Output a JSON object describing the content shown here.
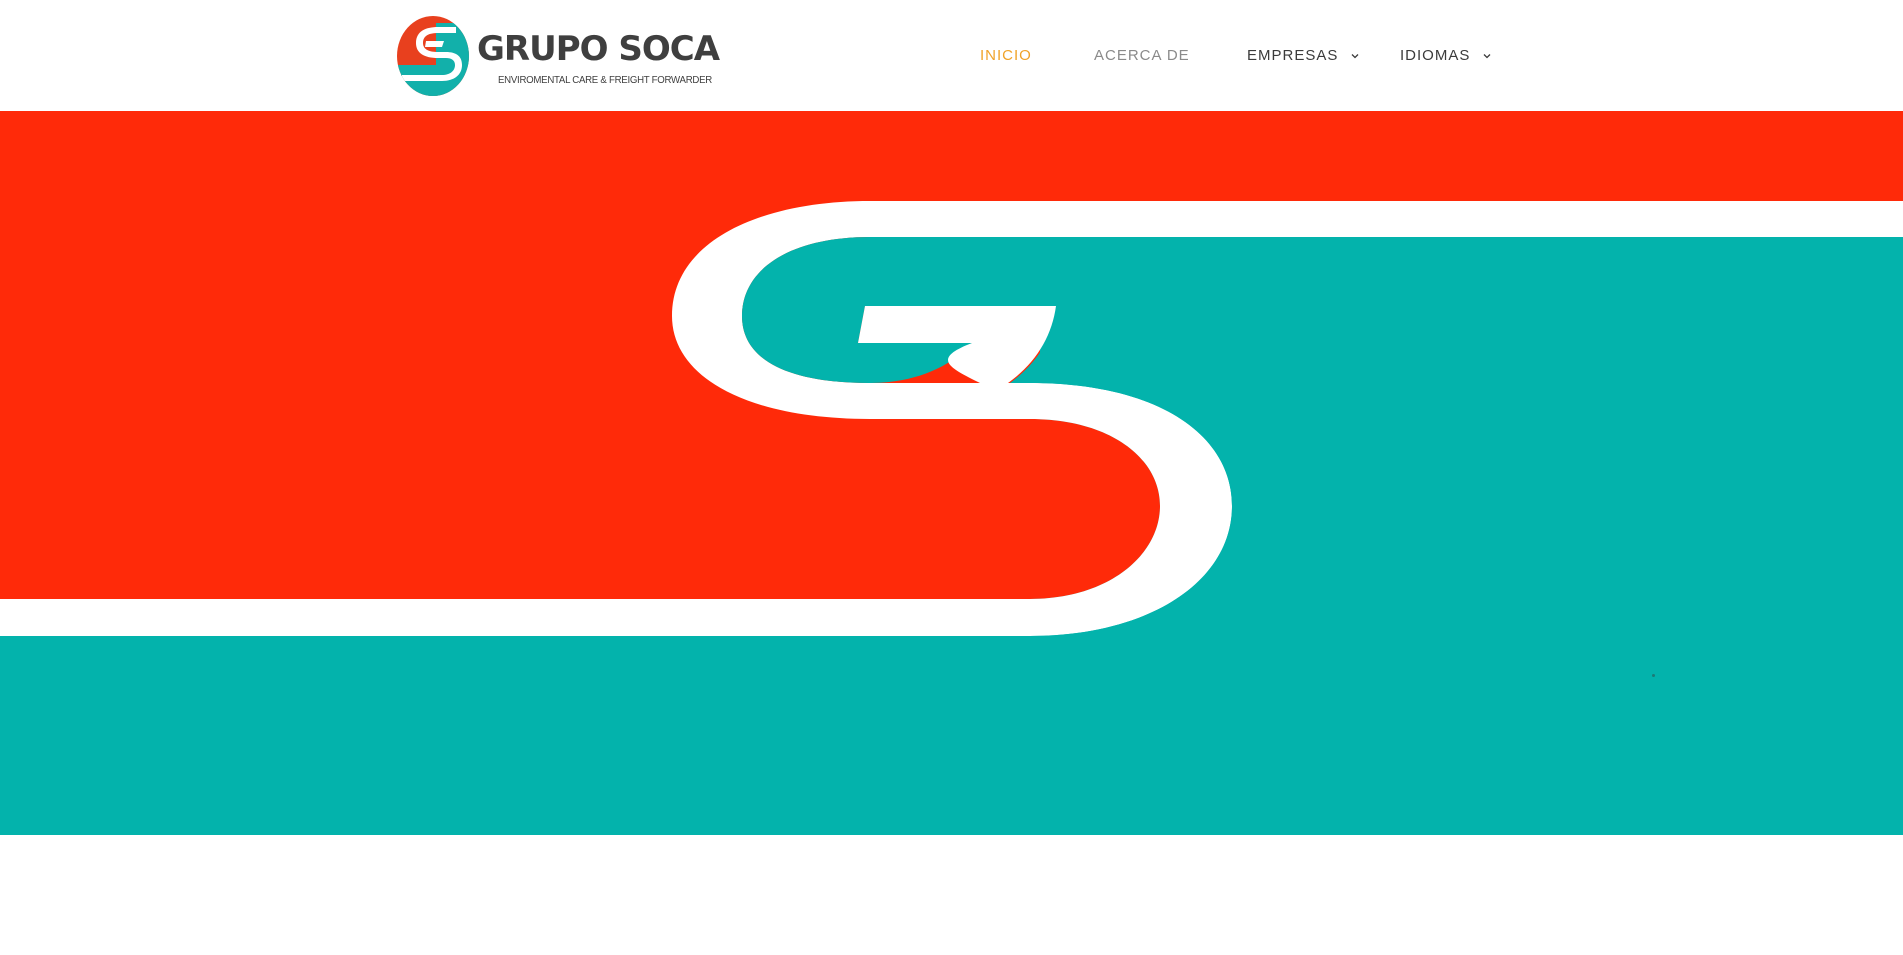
{
  "header": {
    "logo": {
      "title": "GRUPO SOCA",
      "tagline": "ENVIROMENTAL CARE & FREIGHT FORWARDER",
      "icon": "grupo-soca-logo-mark"
    },
    "nav": {
      "items": [
        {
          "label": "INICIO",
          "state": "active"
        },
        {
          "label": "ACERCA DE",
          "state": "normal"
        },
        {
          "label": "EMPRESAS",
          "state": "normal",
          "has_dropdown": true
        },
        {
          "label": "IDIOMAS",
          "state": "normal",
          "has_dropdown": true
        }
      ],
      "dropdown_icon": "chevron-down-icon"
    }
  },
  "hero": {
    "image": "grupo-soca-brand-banner"
  },
  "colors": {
    "brand_red": "#ff2a09",
    "brand_teal": "#03b3ac",
    "nav_active": "#f0a32a",
    "nav_muted": "#8a8a8a",
    "nav_text": "#3b3b3b",
    "logo_text": "#3f3f3f",
    "white": "#ffffff"
  }
}
